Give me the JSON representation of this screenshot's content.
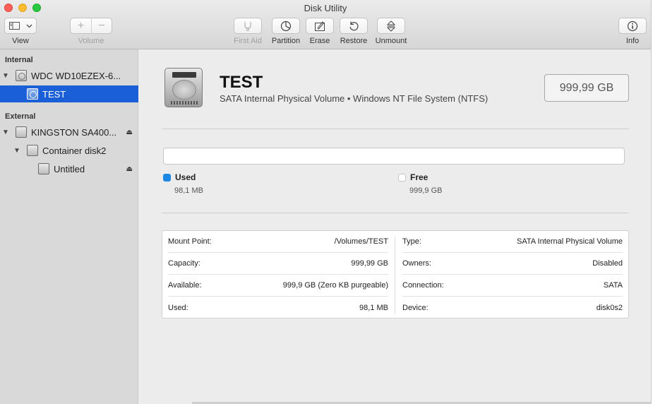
{
  "window": {
    "title": "Disk Utility"
  },
  "toolbar": {
    "view_label": "View",
    "volume_label": "Volume",
    "first_aid_label": "First Aid",
    "partition_label": "Partition",
    "erase_label": "Erase",
    "restore_label": "Restore",
    "unmount_label": "Unmount",
    "info_label": "Info"
  },
  "sidebar": {
    "internal_header": "Internal",
    "external_header": "External",
    "items": [
      {
        "label": "WDC WD10EZEX-6..."
      },
      {
        "label": "TEST"
      },
      {
        "label": "KINGSTON SA400..."
      },
      {
        "label": "Container disk2"
      },
      {
        "label": "Untitled"
      }
    ]
  },
  "volume": {
    "name": "TEST",
    "subtitle": "SATA Internal Physical Volume • Windows NT File System (NTFS)",
    "size": "999,99 GB"
  },
  "usage": {
    "used_label": "Used",
    "used_value": "98,1 MB",
    "free_label": "Free",
    "free_value": "999,9 GB",
    "used_fraction": 0.0001,
    "used_color": "#1c86e3"
  },
  "info": {
    "left": [
      {
        "key": "Mount Point:",
        "value": "/Volumes/TEST"
      },
      {
        "key": "Capacity:",
        "value": "999,99 GB"
      },
      {
        "key": "Available:",
        "value": "999,9 GB (Zero KB purgeable)"
      },
      {
        "key": "Used:",
        "value": "98,1 MB"
      }
    ],
    "right": [
      {
        "key": "Type:",
        "value": "SATA Internal Physical Volume"
      },
      {
        "key": "Owners:",
        "value": "Disabled"
      },
      {
        "key": "Connection:",
        "value": "SATA"
      },
      {
        "key": "Device:",
        "value": "disk0s2"
      }
    ]
  },
  "accent_color": "#1a5fd8"
}
